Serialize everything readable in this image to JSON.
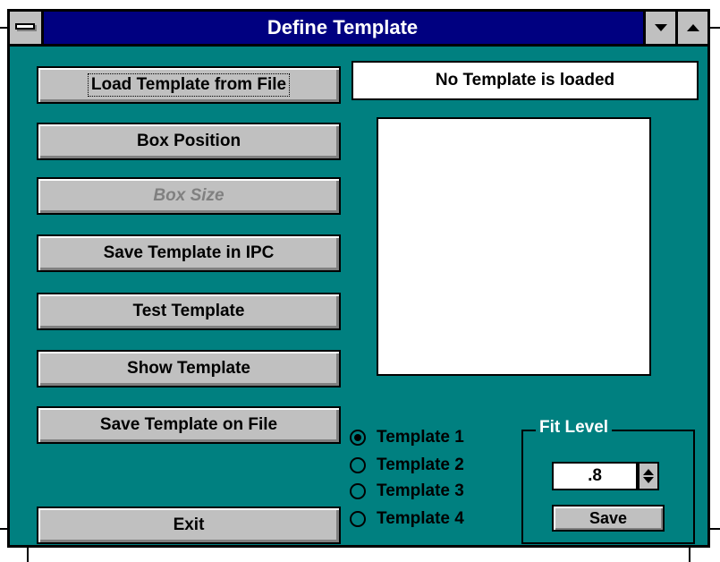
{
  "window": {
    "title": "Define Template"
  },
  "buttons": {
    "load": "Load Template from File",
    "box_position": "Box Position",
    "box_size": "Box Size",
    "save_ipc": "Save Template in IPC",
    "test": "Test Template",
    "show": "Show Template",
    "save_file": "Save Template on File",
    "exit": "Exit"
  },
  "status_text": "No Template is loaded",
  "templates": [
    {
      "label": "Template 1",
      "checked": true
    },
    {
      "label": "Template 2",
      "checked": false
    },
    {
      "label": "Template 3",
      "checked": false
    },
    {
      "label": "Template 4",
      "checked": false
    }
  ],
  "fit_level": {
    "legend": "Fit Level",
    "value": ".8",
    "save_label": "Save"
  },
  "colors": {
    "client_bg": "#008080",
    "titlebar_bg": "#000080",
    "button_face": "#c0c0c0"
  },
  "icons": [
    "system-menu-icon",
    "minimize-arrow-icon",
    "maximize-arrow-icon",
    "spin-up-icon",
    "spin-down-icon",
    "radio-selected-icon"
  ]
}
